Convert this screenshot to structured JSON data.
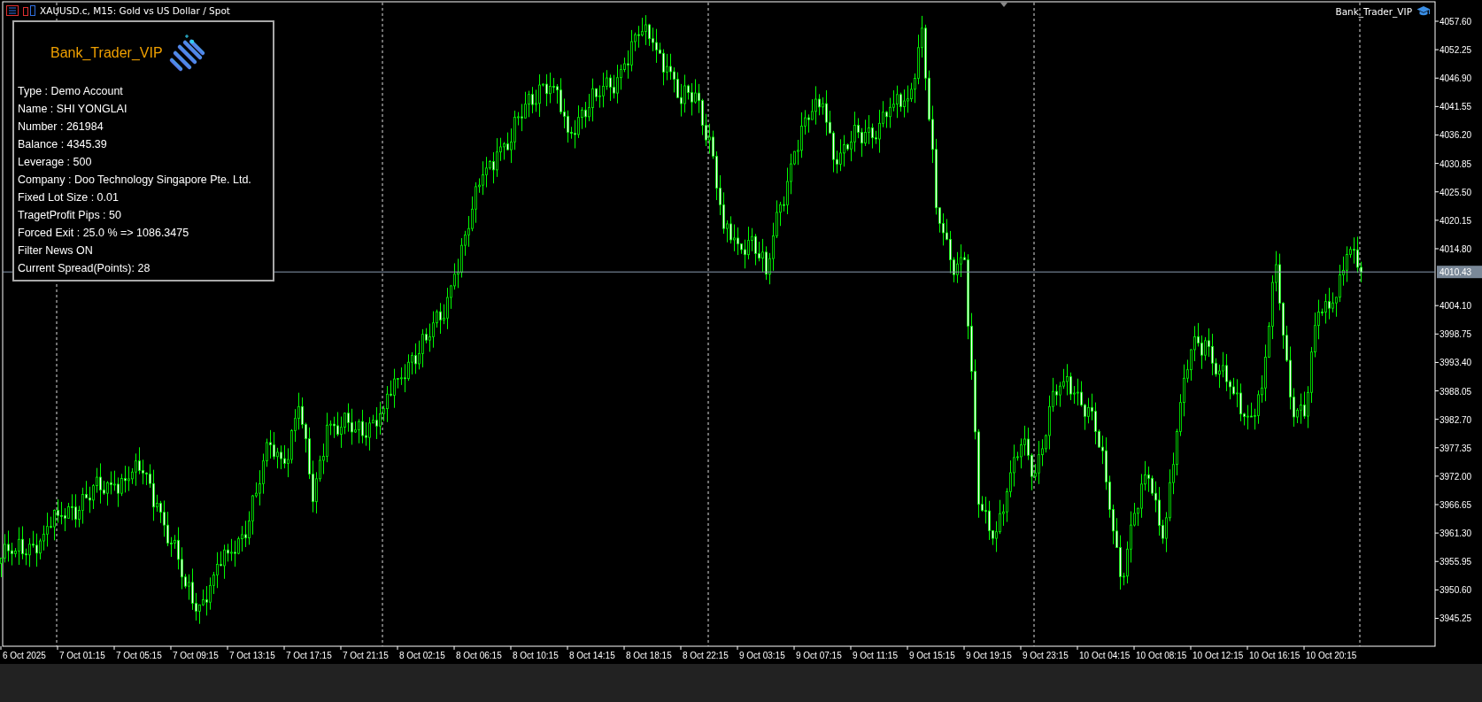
{
  "chart_header": {
    "title": "XAUUSD.c, M15:  Gold vs US Dollar / Spot"
  },
  "expert": {
    "name": "Bank_Trader_VIP"
  },
  "info_panel": {
    "title": "Bank_Trader_VIP",
    "lines": [
      "Type : Demo Account",
      "Name : SHI YONGLAI",
      "Number : 261984",
      "Balance : 4345.39",
      "Leverage : 500",
      "Company : Doo Technology Singapore Pte. Ltd.",
      "Fixed Lot Size : 0.01",
      "TragetProfit Pips : 50",
      "Forced Exit : 25.0 % => 1086.3475",
      "Filter News ON",
      "Current Spread(Points): 28"
    ]
  },
  "chart": {
    "price_axis": [
      "4057.60",
      "4052.25",
      "4046.90",
      "4041.55",
      "4036.20",
      "4030.85",
      "4025.50",
      "4020.15",
      "4014.80",
      "4004.10",
      "3998.75",
      "3993.40",
      "3988.05",
      "3982.70",
      "3977.35",
      "3972.00",
      "3966.65",
      "3961.30",
      "3955.95",
      "3950.60",
      "3945.25"
    ],
    "current_price": "4010.43",
    "time_axis": [
      "6 Oct 2025",
      "7 Oct 01:15",
      "7 Oct 05:15",
      "7 Oct 09:15",
      "7 Oct 13:15",
      "7 Oct 17:15",
      "7 Oct 21:15",
      "8 Oct 02:15",
      "8 Oct 06:15",
      "8 Oct 10:15",
      "8 Oct 14:15",
      "8 Oct 18:15",
      "8 Oct 22:15",
      "9 Oct 03:15",
      "9 Oct 07:15",
      "9 Oct 11:15",
      "9 Oct 15:15",
      "9 Oct 19:15",
      "9 Oct 23:15",
      "10 Oct 04:15",
      "10 Oct 08:15",
      "10 Oct 12:15",
      "10 Oct 16:15",
      "10 Oct 20:15"
    ]
  }
}
